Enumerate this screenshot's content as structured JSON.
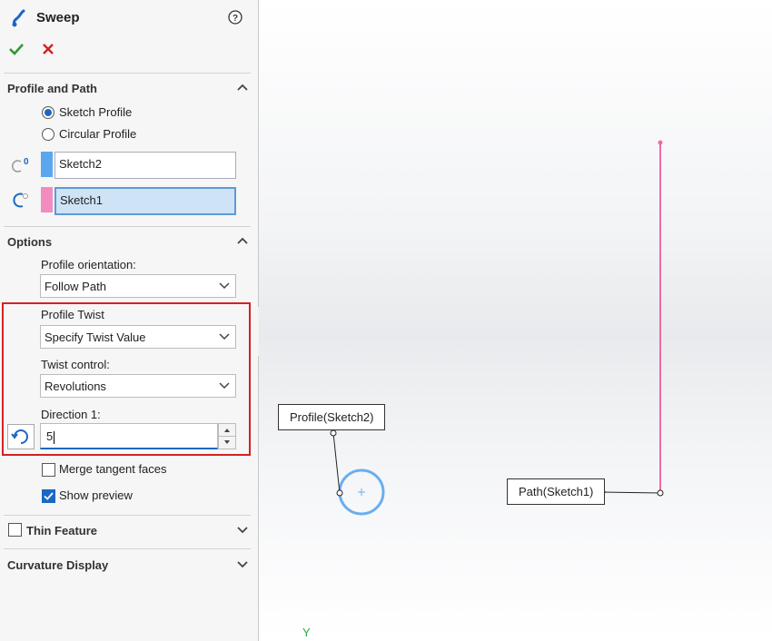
{
  "header": {
    "title": "Sweep",
    "help_icon": "help-icon"
  },
  "actions": {
    "ok_icon": "checkmark-icon",
    "cancel_icon": "close-icon"
  },
  "profile_path": {
    "title": "Profile and Path",
    "radio_sketch": "Sketch Profile",
    "radio_circular": "Circular Profile",
    "profile_value": "Sketch2",
    "path_value": "Sketch1",
    "profile_color": "#5aa7f0",
    "path_color": "#f28cc0"
  },
  "options": {
    "title": "Options",
    "orientation_label": "Profile orientation:",
    "orientation_value": "Follow Path",
    "twist_label": "Profile Twist",
    "twist_value": "Specify Twist Value",
    "twist_control_label": "Twist control:",
    "twist_control_value": "Revolutions",
    "direction_label": "Direction 1:",
    "direction_value": "5",
    "merge_label": "Merge tangent faces",
    "preview_label": "Show preview"
  },
  "thin_feature": {
    "title": "Thin Feature"
  },
  "curvature": {
    "title": "Curvature Display"
  },
  "viewport": {
    "profile_callout": "Profile(Sketch2)",
    "path_callout": "Path(Sketch1)",
    "axis_label": "Y",
    "path_color": "#f06aa8",
    "profile_circle_color": "#6aaef0",
    "axis_color": "#2aa84a",
    "highlight_color": "#d32222"
  }
}
